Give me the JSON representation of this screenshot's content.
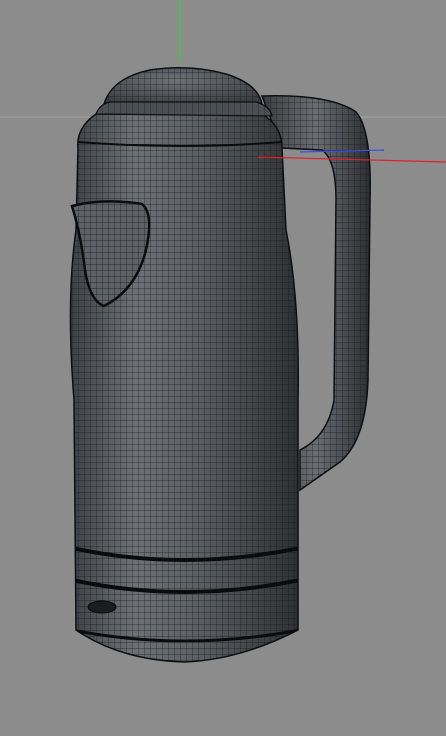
{
  "viewport": {
    "background": "#8c8c8c",
    "horizon_color": "#a3a3a3",
    "axes": {
      "y_color": "#2fd12f",
      "x_color": "#e0202a",
      "z_color": "#3a4ee0"
    }
  },
  "model": {
    "object": "kettle",
    "display_mode": "wireframe-on-shaded",
    "surface_color": "#5a5e63",
    "wire_color": "#101214"
  }
}
